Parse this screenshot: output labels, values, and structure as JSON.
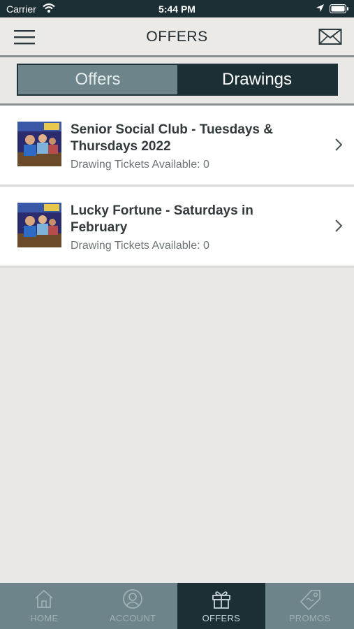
{
  "status_bar": {
    "carrier": "Carrier",
    "time": "5:44 PM"
  },
  "header": {
    "title": "OFFERS"
  },
  "segments": {
    "offers": "Offers",
    "drawings": "Drawings"
  },
  "offers": [
    {
      "title": "Senior Social Club - Tuesdays & Thursdays 2022",
      "subtitle": "Drawing Tickets Available: 0"
    },
    {
      "title": "Lucky Fortune - Saturdays in February",
      "subtitle": "Drawing Tickets Available: 0"
    }
  ],
  "tabs": [
    {
      "label": "HOME",
      "icon": "home-icon"
    },
    {
      "label": "ACCOUNT",
      "icon": "account-icon"
    },
    {
      "label": "OFFERS",
      "icon": "gift-icon"
    },
    {
      "label": "PROMOS",
      "icon": "tag-icon"
    }
  ],
  "colors": {
    "dark": "#1b2f35",
    "slate": "#6c848a",
    "background": "#e9e8e6"
  }
}
